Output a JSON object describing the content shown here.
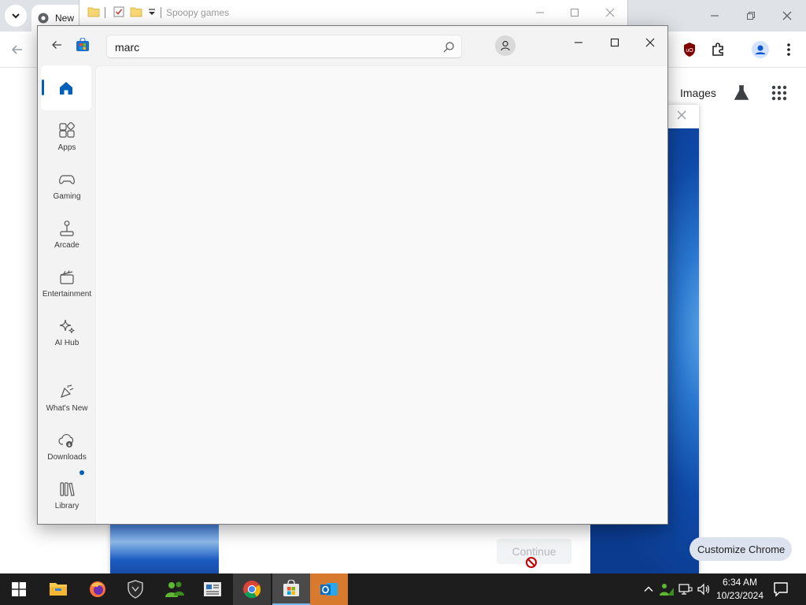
{
  "chrome": {
    "tab_title": "New",
    "images_link": "Images",
    "customize_chip": "Customize Chrome",
    "continue_button": "Continue"
  },
  "explorer": {
    "title": "Spoopy games"
  },
  "store": {
    "search": {
      "value": "marc"
    },
    "nav": {
      "apps": "Apps",
      "gaming": "Gaming",
      "arcade": "Arcade",
      "entertainment": "Entertainment",
      "ai_hub": "AI Hub",
      "whats_new": "What's New",
      "downloads": "Downloads",
      "library": "Library"
    },
    "accent": "#005fb8"
  },
  "taskbar": {
    "time": "6:34 AM",
    "date": "10/23/2024"
  }
}
